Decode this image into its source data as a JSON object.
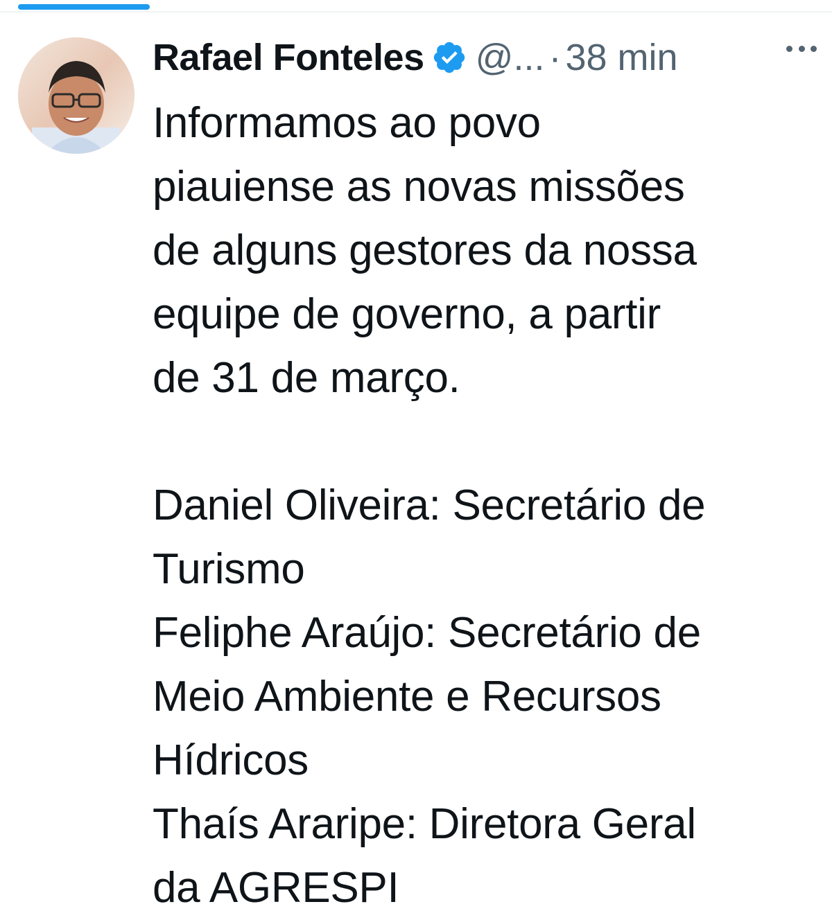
{
  "tweet": {
    "author": {
      "display_name": "Rafael Fonteles",
      "handle": "@...",
      "verified": true
    },
    "separator": "·",
    "timestamp": "38 min",
    "text_intro": [
      "Informamos ao povo",
      "piauiense as novas missões",
      "de alguns gestores da nossa",
      "equipe de governo, a partir",
      "de 31 de março."
    ],
    "text_list": [
      "Daniel Oliveira: Secretário de",
      "Turismo",
      "Feliphe Araújo: Secretário de",
      "Meio Ambiente e Recursos",
      "Hídricos",
      "Thaís Araripe: Diretora Geral",
      "da AGRESPI"
    ]
  },
  "icons": {
    "verified": "verified-badge-icon",
    "more": "more-options-icon"
  },
  "colors": {
    "accent": "#1d9bf0",
    "text_primary": "#0f1419",
    "text_secondary": "#536471"
  }
}
